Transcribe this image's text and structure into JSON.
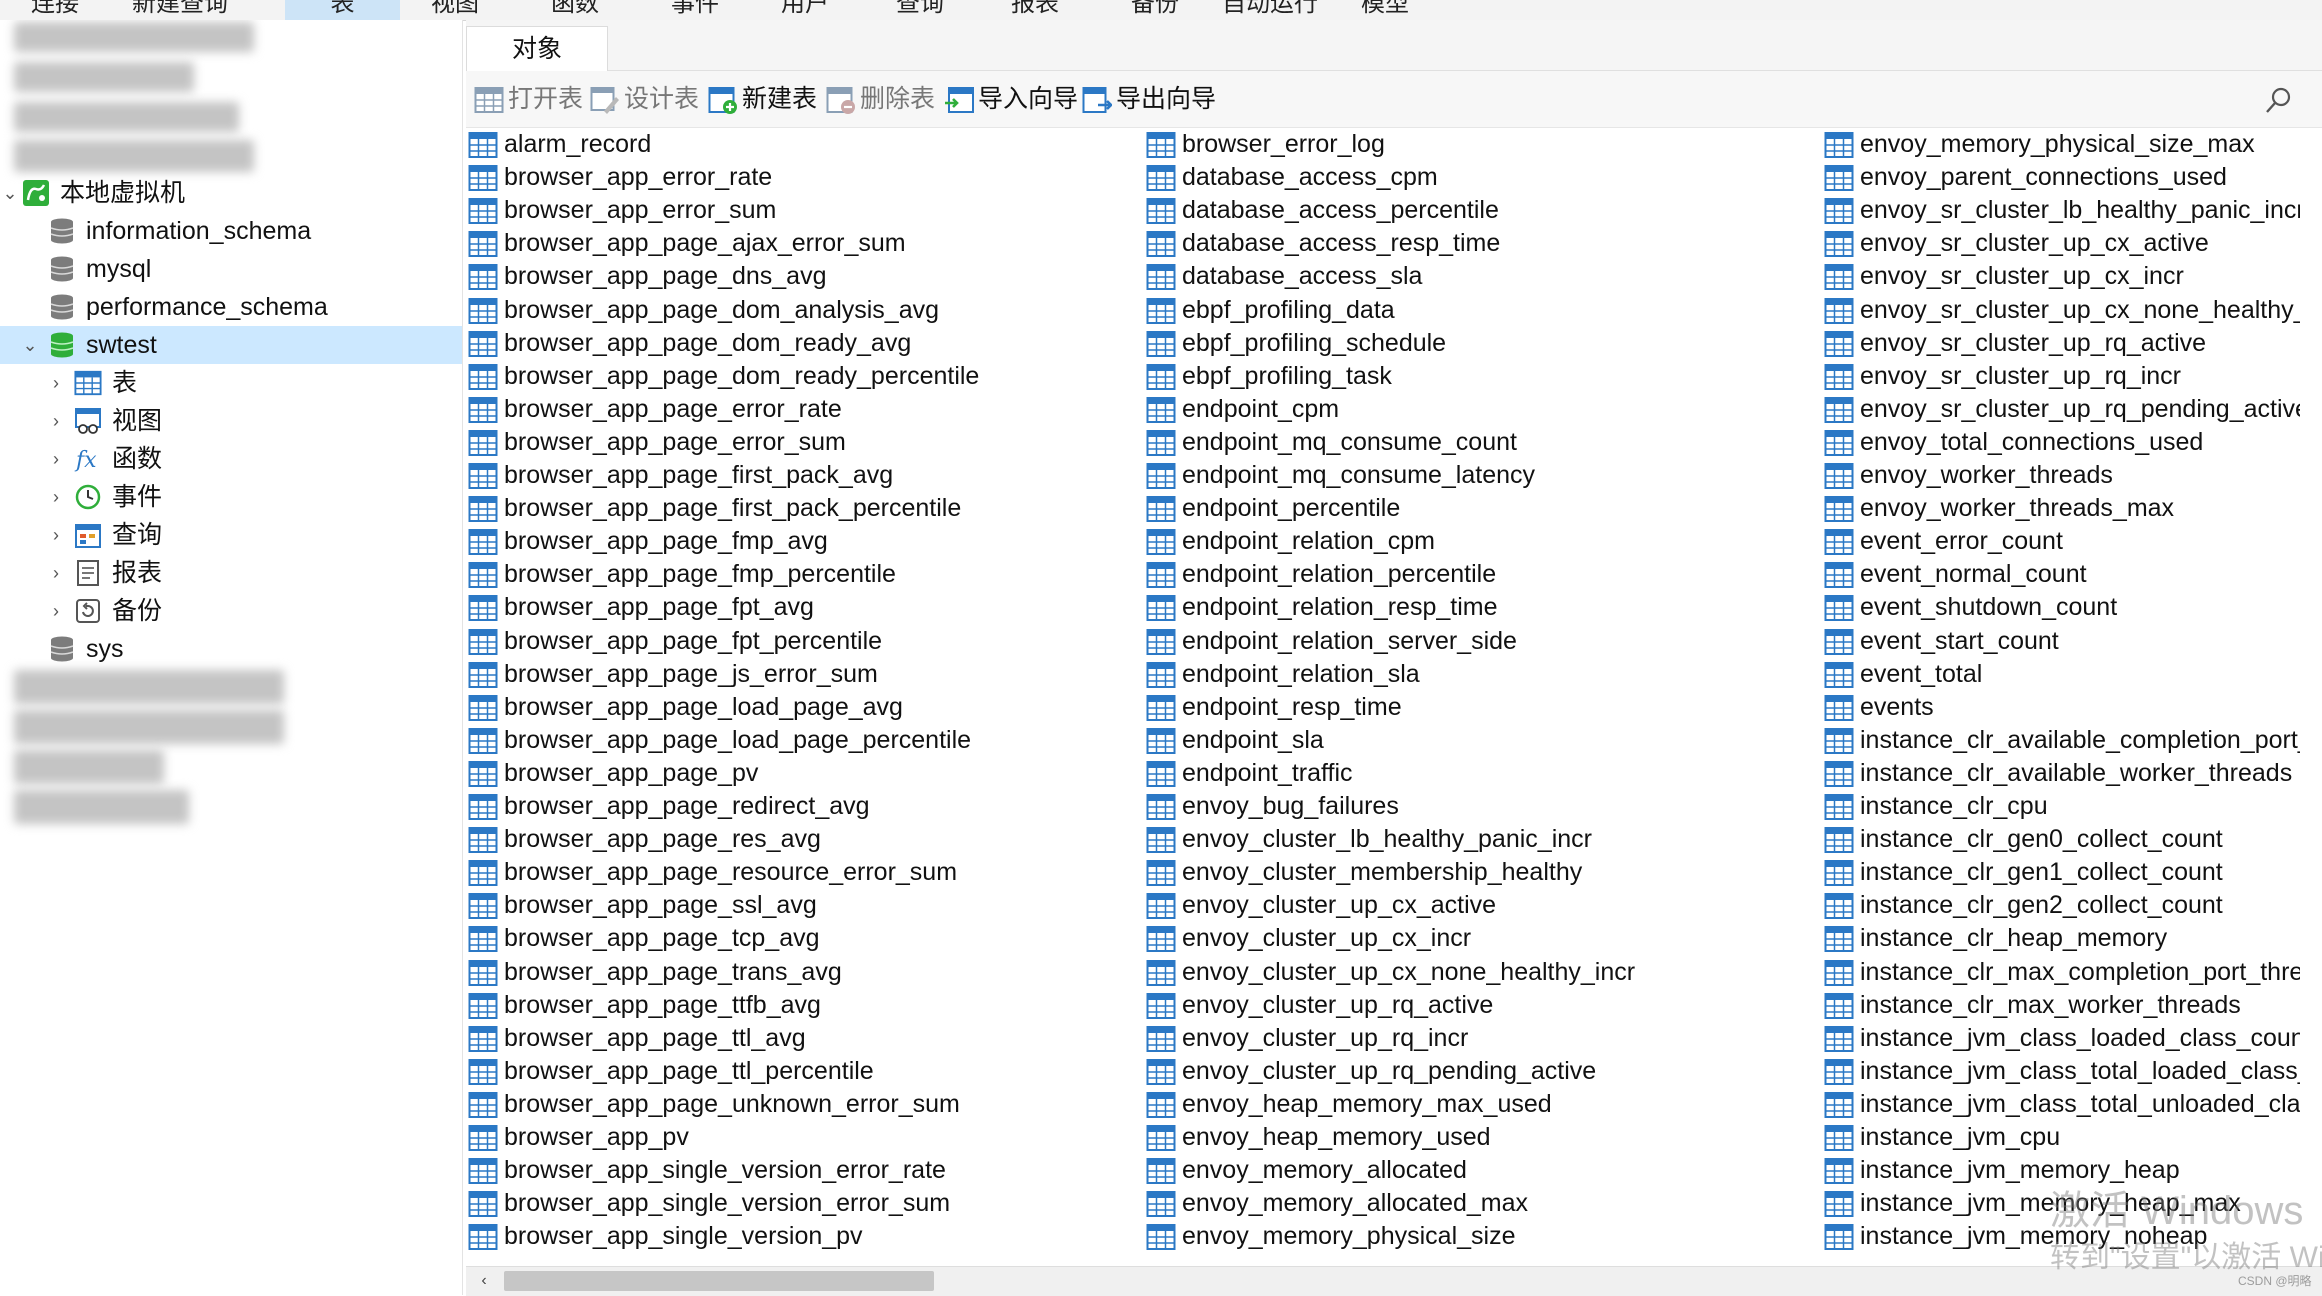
{
  "menu": {
    "items": [
      "连接",
      "新建查询",
      "表",
      "视图",
      "函数",
      "事件",
      "用户",
      "查询",
      "报表",
      "备份",
      "自动运行",
      "模型"
    ],
    "active": "表"
  },
  "tree": {
    "connection": "本地虚拟机",
    "databases": [
      "information_schema",
      "mysql",
      "performance_schema",
      "swtest",
      "sys"
    ],
    "selected_db": "swtest",
    "children": [
      "表",
      "视图",
      "函数",
      "事件",
      "查询",
      "报表",
      "备份"
    ]
  },
  "tabs": {
    "objects": "对象"
  },
  "toolbar": {
    "open_table": "打开表",
    "design_table": "设计表",
    "new_table": "新建表",
    "delete_table": "删除表",
    "import_wizard": "导入向导",
    "export_wizard": "导出向导"
  },
  "columns": [
    [
      "alarm_record",
      "browser_app_error_rate",
      "browser_app_error_sum",
      "browser_app_page_ajax_error_sum",
      "browser_app_page_dns_avg",
      "browser_app_page_dom_analysis_avg",
      "browser_app_page_dom_ready_avg",
      "browser_app_page_dom_ready_percentile",
      "browser_app_page_error_rate",
      "browser_app_page_error_sum",
      "browser_app_page_first_pack_avg",
      "browser_app_page_first_pack_percentile",
      "browser_app_page_fmp_avg",
      "browser_app_page_fmp_percentile",
      "browser_app_page_fpt_avg",
      "browser_app_page_fpt_percentile",
      "browser_app_page_js_error_sum",
      "browser_app_page_load_page_avg",
      "browser_app_page_load_page_percentile",
      "browser_app_page_pv",
      "browser_app_page_redirect_avg",
      "browser_app_page_res_avg",
      "browser_app_page_resource_error_sum",
      "browser_app_page_ssl_avg",
      "browser_app_page_tcp_avg",
      "browser_app_page_trans_avg",
      "browser_app_page_ttfb_avg",
      "browser_app_page_ttl_avg",
      "browser_app_page_ttl_percentile",
      "browser_app_page_unknown_error_sum",
      "browser_app_pv",
      "browser_app_single_version_error_rate",
      "browser_app_single_version_error_sum",
      "browser_app_single_version_pv"
    ],
    [
      "browser_error_log",
      "database_access_cpm",
      "database_access_percentile",
      "database_access_resp_time",
      "database_access_sla",
      "ebpf_profiling_data",
      "ebpf_profiling_schedule",
      "ebpf_profiling_task",
      "endpoint_cpm",
      "endpoint_mq_consume_count",
      "endpoint_mq_consume_latency",
      "endpoint_percentile",
      "endpoint_relation_cpm",
      "endpoint_relation_percentile",
      "endpoint_relation_resp_time",
      "endpoint_relation_server_side",
      "endpoint_relation_sla",
      "endpoint_resp_time",
      "endpoint_sla",
      "endpoint_traffic",
      "envoy_bug_failures",
      "envoy_cluster_lb_healthy_panic_incr",
      "envoy_cluster_membership_healthy",
      "envoy_cluster_up_cx_active",
      "envoy_cluster_up_cx_incr",
      "envoy_cluster_up_cx_none_healthy_incr",
      "envoy_cluster_up_rq_active",
      "envoy_cluster_up_rq_incr",
      "envoy_cluster_up_rq_pending_active",
      "envoy_heap_memory_max_used",
      "envoy_heap_memory_used",
      "envoy_memory_allocated",
      "envoy_memory_allocated_max",
      "envoy_memory_physical_size"
    ],
    [
      "envoy_memory_physical_size_max",
      "envoy_parent_connections_used",
      "envoy_sr_cluster_lb_healthy_panic_incr",
      "envoy_sr_cluster_up_cx_active",
      "envoy_sr_cluster_up_cx_incr",
      "envoy_sr_cluster_up_cx_none_healthy_incr",
      "envoy_sr_cluster_up_rq_active",
      "envoy_sr_cluster_up_rq_incr",
      "envoy_sr_cluster_up_rq_pending_active",
      "envoy_total_connections_used",
      "envoy_worker_threads",
      "envoy_worker_threads_max",
      "event_error_count",
      "event_normal_count",
      "event_shutdown_count",
      "event_start_count",
      "event_total",
      "events",
      "instance_clr_available_completion_port_threads",
      "instance_clr_available_worker_threads",
      "instance_clr_cpu",
      "instance_clr_gen0_collect_count",
      "instance_clr_gen1_collect_count",
      "instance_clr_gen2_collect_count",
      "instance_clr_heap_memory",
      "instance_clr_max_completion_port_threads",
      "instance_clr_max_worker_threads",
      "instance_jvm_class_loaded_class_count",
      "instance_jvm_class_total_loaded_class_count",
      "instance_jvm_class_total_unloaded_class_count",
      "instance_jvm_cpu",
      "instance_jvm_memory_heap",
      "instance_jvm_memory_heap_max",
      "instance_jvm_memory_noheap"
    ]
  ],
  "watermark": {
    "line1": "激活 Windows",
    "line2": "转到\"设置\"以激活 Wi"
  },
  "credit": "CSDN @明略",
  "colors": {
    "selected_bg": "#cce8ff",
    "table_icon": "#2b78c5",
    "db_green": "#2fae3a"
  }
}
